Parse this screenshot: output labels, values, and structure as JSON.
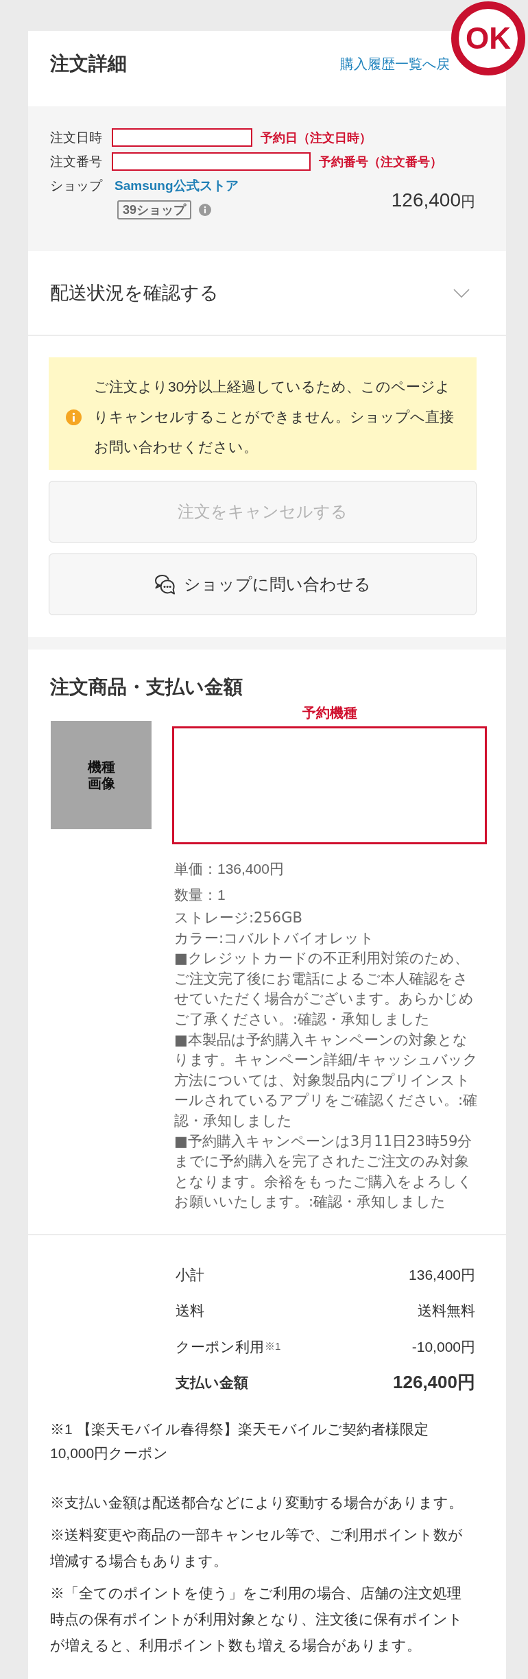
{
  "stamp": {
    "label": "OK"
  },
  "header": {
    "title": "注文詳細",
    "back_link": "購入履歴一覧へ戻"
  },
  "order_info": {
    "rows": [
      {
        "kind": "redacted",
        "label": "注文日時",
        "note": "予約日（注文日時）"
      },
      {
        "kind": "redacted",
        "label": "注文番号",
        "note": "予約番号（注文番号）"
      },
      {
        "kind": "shop",
        "label": "ショップ",
        "value": "Samsung公式ストア",
        "badge": "39ショップ"
      }
    ],
    "total": {
      "amount": "126,400",
      "unit": "円"
    }
  },
  "delivery": {
    "label": "配送状況を確認する",
    "expanded": false
  },
  "notice": {
    "message": "ご注文より30分以上経過しているため、このページよりキャンセルすることができません。ショップへ直接お問い合わせください。"
  },
  "actions": [
    {
      "kind": "cancel",
      "label": "注文をキャンセルする",
      "disabled": true
    },
    {
      "kind": "contact",
      "label": "ショップに問い合わせる",
      "disabled": false
    }
  ],
  "product": {
    "title": "注文商品・支払い金額",
    "image_label": "機種画像",
    "name_note": "予約機種",
    "unit_price": "単価：136,400円",
    "quantity": "数量：1",
    "options": [
      "ストレージ:256GB",
      "カラー:コバルトバイオレット",
      "■クレジットカードの不正利用対策のため、ご注文完了後にお電話によるご本人確認をさせていただく場合がございます。あらかじめご了承ください。:確認・承知しました",
      "■本製品は予約購入キャンペーンの対象となります。キャンペーン詳細/キャッシュバック方法については、対象製品内にプリインストールされているアプリをご確認ください。:確認・承知しました",
      "■予約購入キャンペーンは3月11日23時59分までに予約購入を完了されたご注文のみ対象となります。余裕をもったご購入をよろしくお願いいたします。:確認・承知しました"
    ]
  },
  "summary": {
    "rows": [
      {
        "kind": "line",
        "label": "小計",
        "value": "136,400円"
      },
      {
        "kind": "line",
        "label": "送料",
        "value": "送料無料"
      },
      {
        "kind": "line",
        "label": "クーポン利用",
        "mark": "※1",
        "value": "-10,000円"
      },
      {
        "kind": "total",
        "label": "支払い金額",
        "value": "126,400円"
      }
    ],
    "footnote": "※1 【楽天モバイル春得祭】楽天モバイルご契約者様限定10,000円クーポン",
    "notes": [
      "※支払い金額は配送都合などにより変動する場合があります。",
      "※送料変更や商品の一部キャンセル等で、ご利用ポイント数が増減する場合もあります。",
      "※「全てのポイントを使う」をご利用の場合、店舗の注文処理時点の保有ポイントが利用対象となり、注文後に保有ポイントが増えると、利用ポイント数も増える場合があります。"
    ]
  }
}
